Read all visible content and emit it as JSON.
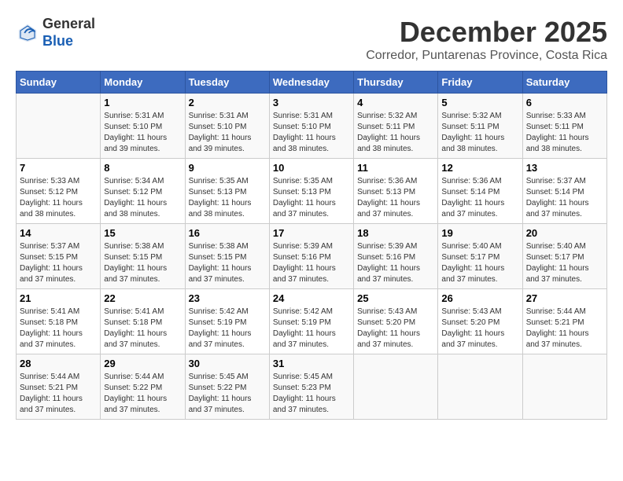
{
  "header": {
    "logo_line1": "General",
    "logo_line2": "Blue",
    "month": "December 2025",
    "location": "Corredor, Puntarenas Province, Costa Rica"
  },
  "weekdays": [
    "Sunday",
    "Monday",
    "Tuesday",
    "Wednesday",
    "Thursday",
    "Friday",
    "Saturday"
  ],
  "weeks": [
    [
      {
        "day": "",
        "sunrise": "",
        "sunset": "",
        "daylight": ""
      },
      {
        "day": "1",
        "sunrise": "Sunrise: 5:31 AM",
        "sunset": "Sunset: 5:10 PM",
        "daylight": "Daylight: 11 hours and 39 minutes."
      },
      {
        "day": "2",
        "sunrise": "Sunrise: 5:31 AM",
        "sunset": "Sunset: 5:10 PM",
        "daylight": "Daylight: 11 hours and 39 minutes."
      },
      {
        "day": "3",
        "sunrise": "Sunrise: 5:31 AM",
        "sunset": "Sunset: 5:10 PM",
        "daylight": "Daylight: 11 hours and 38 minutes."
      },
      {
        "day": "4",
        "sunrise": "Sunrise: 5:32 AM",
        "sunset": "Sunset: 5:11 PM",
        "daylight": "Daylight: 11 hours and 38 minutes."
      },
      {
        "day": "5",
        "sunrise": "Sunrise: 5:32 AM",
        "sunset": "Sunset: 5:11 PM",
        "daylight": "Daylight: 11 hours and 38 minutes."
      },
      {
        "day": "6",
        "sunrise": "Sunrise: 5:33 AM",
        "sunset": "Sunset: 5:11 PM",
        "daylight": "Daylight: 11 hours and 38 minutes."
      }
    ],
    [
      {
        "day": "7",
        "sunrise": "Sunrise: 5:33 AM",
        "sunset": "Sunset: 5:12 PM",
        "daylight": "Daylight: 11 hours and 38 minutes."
      },
      {
        "day": "8",
        "sunrise": "Sunrise: 5:34 AM",
        "sunset": "Sunset: 5:12 PM",
        "daylight": "Daylight: 11 hours and 38 minutes."
      },
      {
        "day": "9",
        "sunrise": "Sunrise: 5:35 AM",
        "sunset": "Sunset: 5:13 PM",
        "daylight": "Daylight: 11 hours and 38 minutes."
      },
      {
        "day": "10",
        "sunrise": "Sunrise: 5:35 AM",
        "sunset": "Sunset: 5:13 PM",
        "daylight": "Daylight: 11 hours and 37 minutes."
      },
      {
        "day": "11",
        "sunrise": "Sunrise: 5:36 AM",
        "sunset": "Sunset: 5:13 PM",
        "daylight": "Daylight: 11 hours and 37 minutes."
      },
      {
        "day": "12",
        "sunrise": "Sunrise: 5:36 AM",
        "sunset": "Sunset: 5:14 PM",
        "daylight": "Daylight: 11 hours and 37 minutes."
      },
      {
        "day": "13",
        "sunrise": "Sunrise: 5:37 AM",
        "sunset": "Sunset: 5:14 PM",
        "daylight": "Daylight: 11 hours and 37 minutes."
      }
    ],
    [
      {
        "day": "14",
        "sunrise": "Sunrise: 5:37 AM",
        "sunset": "Sunset: 5:15 PM",
        "daylight": "Daylight: 11 hours and 37 minutes."
      },
      {
        "day": "15",
        "sunrise": "Sunrise: 5:38 AM",
        "sunset": "Sunset: 5:15 PM",
        "daylight": "Daylight: 11 hours and 37 minutes."
      },
      {
        "day": "16",
        "sunrise": "Sunrise: 5:38 AM",
        "sunset": "Sunset: 5:15 PM",
        "daylight": "Daylight: 11 hours and 37 minutes."
      },
      {
        "day": "17",
        "sunrise": "Sunrise: 5:39 AM",
        "sunset": "Sunset: 5:16 PM",
        "daylight": "Daylight: 11 hours and 37 minutes."
      },
      {
        "day": "18",
        "sunrise": "Sunrise: 5:39 AM",
        "sunset": "Sunset: 5:16 PM",
        "daylight": "Daylight: 11 hours and 37 minutes."
      },
      {
        "day": "19",
        "sunrise": "Sunrise: 5:40 AM",
        "sunset": "Sunset: 5:17 PM",
        "daylight": "Daylight: 11 hours and 37 minutes."
      },
      {
        "day": "20",
        "sunrise": "Sunrise: 5:40 AM",
        "sunset": "Sunset: 5:17 PM",
        "daylight": "Daylight: 11 hours and 37 minutes."
      }
    ],
    [
      {
        "day": "21",
        "sunrise": "Sunrise: 5:41 AM",
        "sunset": "Sunset: 5:18 PM",
        "daylight": "Daylight: 11 hours and 37 minutes."
      },
      {
        "day": "22",
        "sunrise": "Sunrise: 5:41 AM",
        "sunset": "Sunset: 5:18 PM",
        "daylight": "Daylight: 11 hours and 37 minutes."
      },
      {
        "day": "23",
        "sunrise": "Sunrise: 5:42 AM",
        "sunset": "Sunset: 5:19 PM",
        "daylight": "Daylight: 11 hours and 37 minutes."
      },
      {
        "day": "24",
        "sunrise": "Sunrise: 5:42 AM",
        "sunset": "Sunset: 5:19 PM",
        "daylight": "Daylight: 11 hours and 37 minutes."
      },
      {
        "day": "25",
        "sunrise": "Sunrise: 5:43 AM",
        "sunset": "Sunset: 5:20 PM",
        "daylight": "Daylight: 11 hours and 37 minutes."
      },
      {
        "day": "26",
        "sunrise": "Sunrise: 5:43 AM",
        "sunset": "Sunset: 5:20 PM",
        "daylight": "Daylight: 11 hours and 37 minutes."
      },
      {
        "day": "27",
        "sunrise": "Sunrise: 5:44 AM",
        "sunset": "Sunset: 5:21 PM",
        "daylight": "Daylight: 11 hours and 37 minutes."
      }
    ],
    [
      {
        "day": "28",
        "sunrise": "Sunrise: 5:44 AM",
        "sunset": "Sunset: 5:21 PM",
        "daylight": "Daylight: 11 hours and 37 minutes."
      },
      {
        "day": "29",
        "sunrise": "Sunrise: 5:44 AM",
        "sunset": "Sunset: 5:22 PM",
        "daylight": "Daylight: 11 hours and 37 minutes."
      },
      {
        "day": "30",
        "sunrise": "Sunrise: 5:45 AM",
        "sunset": "Sunset: 5:22 PM",
        "daylight": "Daylight: 11 hours and 37 minutes."
      },
      {
        "day": "31",
        "sunrise": "Sunrise: 5:45 AM",
        "sunset": "Sunset: 5:23 PM",
        "daylight": "Daylight: 11 hours and 37 minutes."
      },
      {
        "day": "",
        "sunrise": "",
        "sunset": "",
        "daylight": ""
      },
      {
        "day": "",
        "sunrise": "",
        "sunset": "",
        "daylight": ""
      },
      {
        "day": "",
        "sunrise": "",
        "sunset": "",
        "daylight": ""
      }
    ]
  ]
}
